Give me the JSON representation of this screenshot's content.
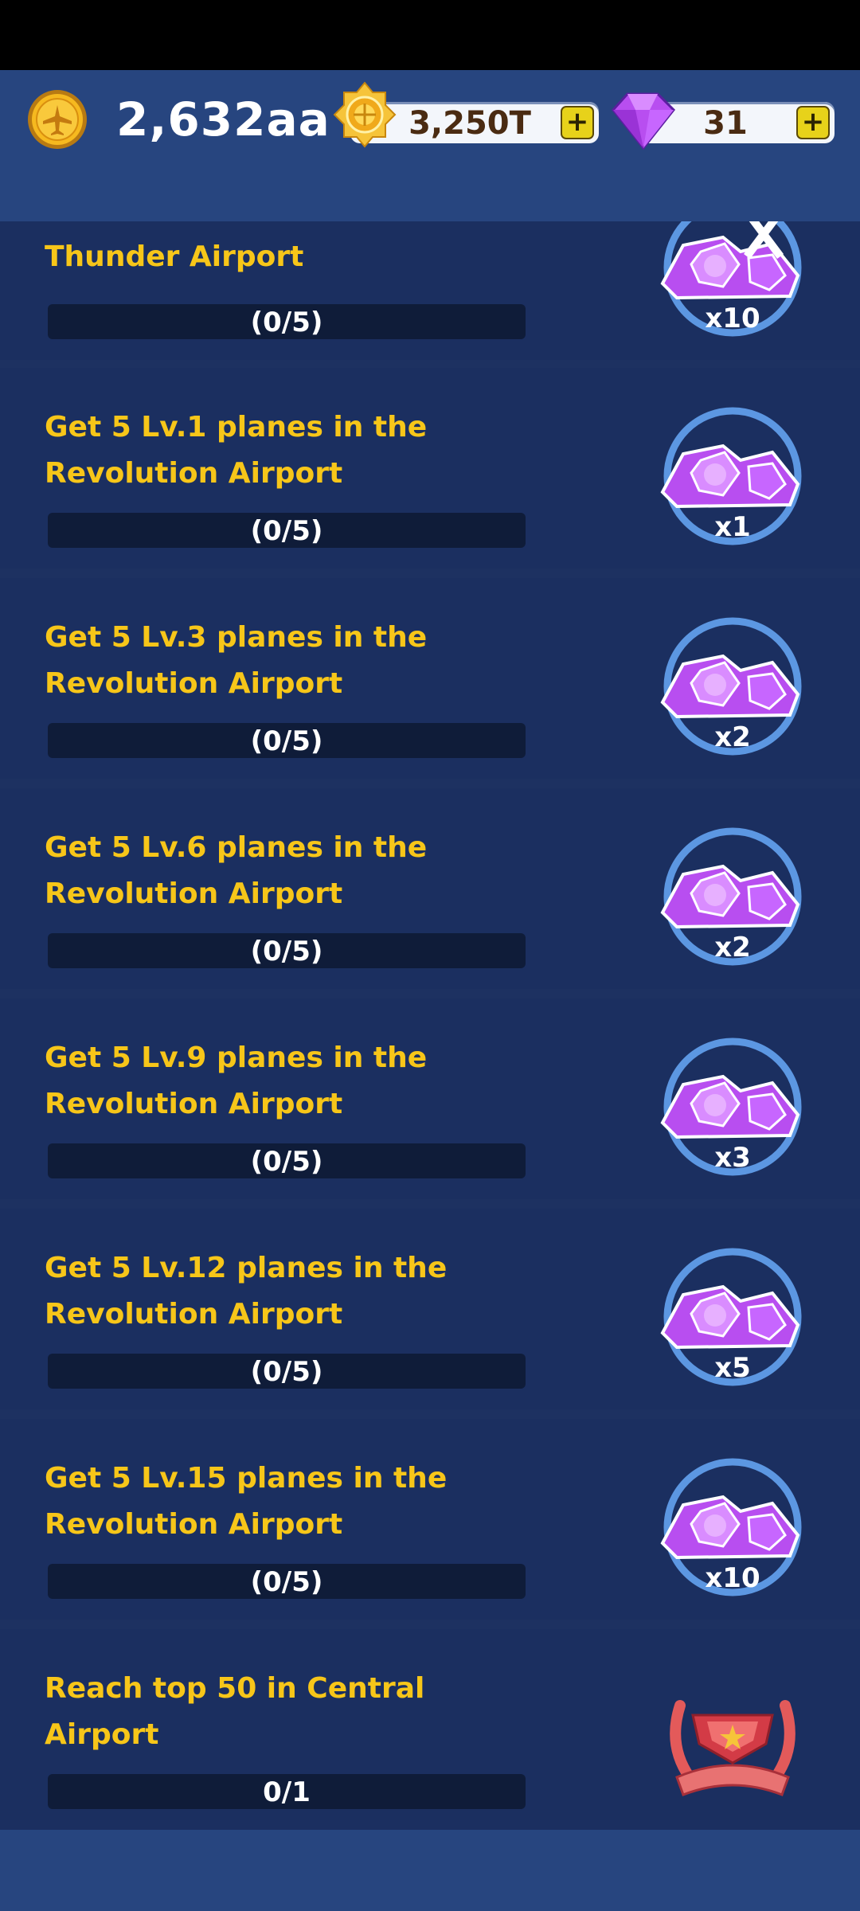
{
  "header": {
    "coins": "2,632aa",
    "medals": "3,250T",
    "gems": "31",
    "plus_label": "+"
  },
  "missions": [
    {
      "title": "Thunder Airport",
      "progress": "(0/5)",
      "reward_count": "x10",
      "reward_icon": "gem-pile-icon"
    },
    {
      "title": "Get 5 Lv.1 planes in the Revolution Airport",
      "progress": "(0/5)",
      "reward_count": "x1",
      "reward_icon": "gem-pile-icon"
    },
    {
      "title": "Get 5 Lv.3 planes in the Revolution Airport",
      "progress": "(0/5)",
      "reward_count": "x2",
      "reward_icon": "gem-pile-icon"
    },
    {
      "title": "Get 5 Lv.6 planes in the Revolution Airport",
      "progress": "(0/5)",
      "reward_count": "x2",
      "reward_icon": "gem-pile-icon"
    },
    {
      "title": "Get 5 Lv.9 planes in the Revolution Airport",
      "progress": "(0/5)",
      "reward_count": "x3",
      "reward_icon": "gem-pile-icon"
    },
    {
      "title": "Get 5 Lv.12 planes in the Revolution Airport",
      "progress": "(0/5)",
      "reward_count": "x5",
      "reward_icon": "gem-pile-icon"
    },
    {
      "title": "Get 5 Lv.15 planes in the Revolution Airport",
      "progress": "(0/5)",
      "reward_count": "x10",
      "reward_icon": "gem-pile-icon"
    },
    {
      "title": "Reach top 50 in Central Airport",
      "progress": "0/1",
      "reward_count": "",
      "reward_icon": "rank-badge-icon"
    }
  ],
  "colors": {
    "background": "#1d3161",
    "card": "#1b2f60",
    "title": "#f7c619",
    "progress_track": "#0f1c39",
    "gem": "#b84ef0",
    "gold": "#f3b61f"
  }
}
